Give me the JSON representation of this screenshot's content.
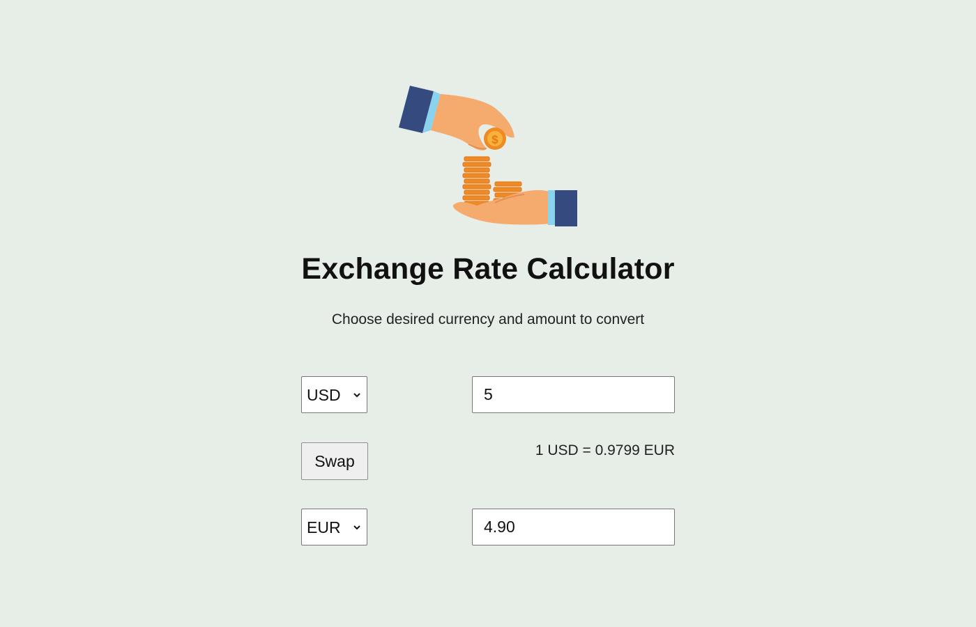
{
  "header": {
    "title": "Exchange Rate Calculator",
    "subtitle": "Choose desired currency and amount to convert",
    "hero_icon": "hands-exchanging-coins-icon"
  },
  "converter": {
    "from": {
      "currency": "USD",
      "amount": "5"
    },
    "swap_label": "Swap",
    "rate_text": "1 USD = 0.9799 EUR",
    "to": {
      "currency": "EUR",
      "amount": "4.90"
    }
  },
  "colors": {
    "background": "#e7eee8",
    "sleeve": "#354b80",
    "cuff": "#8ad3ef",
    "skin": "#f5ab6e",
    "coin": "#f08a24",
    "coin_light": "#f6b23a"
  }
}
